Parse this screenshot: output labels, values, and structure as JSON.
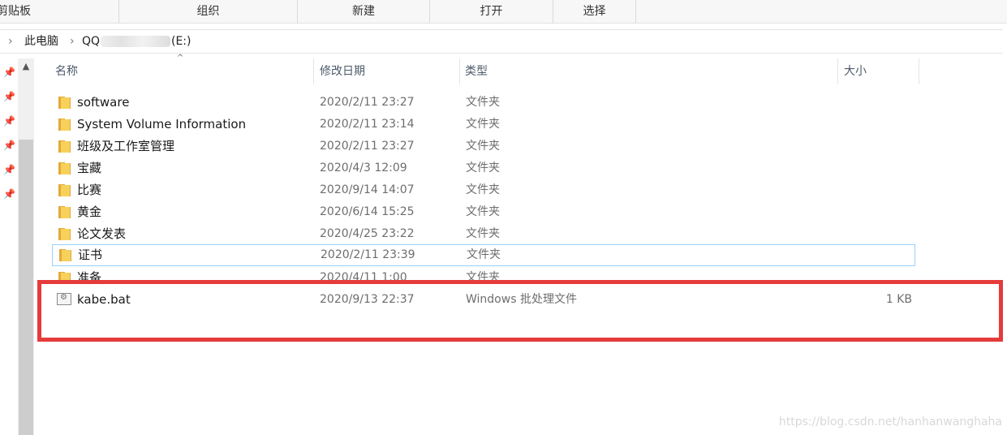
{
  "ribbon": {
    "groups": [
      "剪贴板",
      "组织",
      "新建",
      "打开",
      "选择"
    ]
  },
  "address": {
    "breadcrumb": [
      "此电脑",
      "QQ",
      "(E:)"
    ]
  },
  "columns": {
    "name": "名称",
    "date": "修改日期",
    "type": "类型",
    "size": "大小"
  },
  "files": [
    {
      "name": "software",
      "date": "2020/2/11 23:27",
      "type": "文件夹",
      "size": "",
      "kind": "folder"
    },
    {
      "name": "System Volume Information",
      "date": "2020/2/11 23:14",
      "type": "文件夹",
      "size": "",
      "kind": "folder"
    },
    {
      "name": "班级及工作室管理",
      "date": "2020/2/11 23:27",
      "type": "文件夹",
      "size": "",
      "kind": "folder"
    },
    {
      "name": "宝藏",
      "date": "2020/4/3 12:09",
      "type": "文件夹",
      "size": "",
      "kind": "folder"
    },
    {
      "name": "比赛",
      "date": "2020/9/14 14:07",
      "type": "文件夹",
      "size": "",
      "kind": "folder"
    },
    {
      "name": "黄金",
      "date": "2020/6/14 15:25",
      "type": "文件夹",
      "size": "",
      "kind": "folder"
    },
    {
      "name": "论文发表",
      "date": "2020/4/25 23:22",
      "type": "文件夹",
      "size": "",
      "kind": "folder"
    },
    {
      "name": "证书",
      "date": "2020/2/11 23:39",
      "type": "文件夹",
      "size": "",
      "kind": "folder"
    },
    {
      "name": "准备",
      "date": "2020/4/11 1:00",
      "type": "文件夹",
      "size": "",
      "kind": "folder"
    },
    {
      "name": "kabe.bat",
      "date": "2020/9/13 22:37",
      "type": "Windows 批处理文件",
      "size": "1 KB",
      "kind": "bat"
    }
  ],
  "watermark": "https://blog.csdn.net/hanhanwanghaha"
}
